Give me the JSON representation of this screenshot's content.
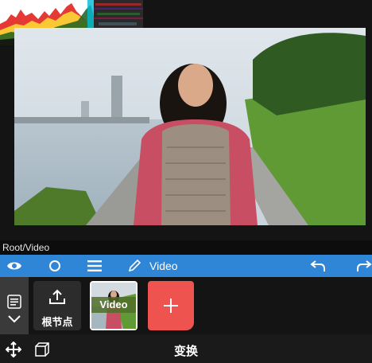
{
  "path": "Root/Video",
  "toolbar": {
    "layer_name": "Video"
  },
  "nodes": {
    "root_label": "根节点",
    "video_label": "Video"
  },
  "bottom": {
    "title": "变换"
  },
  "icons": [
    "eye-icon",
    "circle-icon",
    "menu-icon",
    "pencil-icon",
    "undo-icon",
    "redo-icon",
    "upload-icon",
    "plus-icon",
    "list-icon",
    "chevron-down-icon",
    "move-icon",
    "cube-icon"
  ],
  "colors": {
    "toolbar": "#2f86d6",
    "add_button": "#ef5350",
    "node_bg": "#2c2c2c"
  }
}
